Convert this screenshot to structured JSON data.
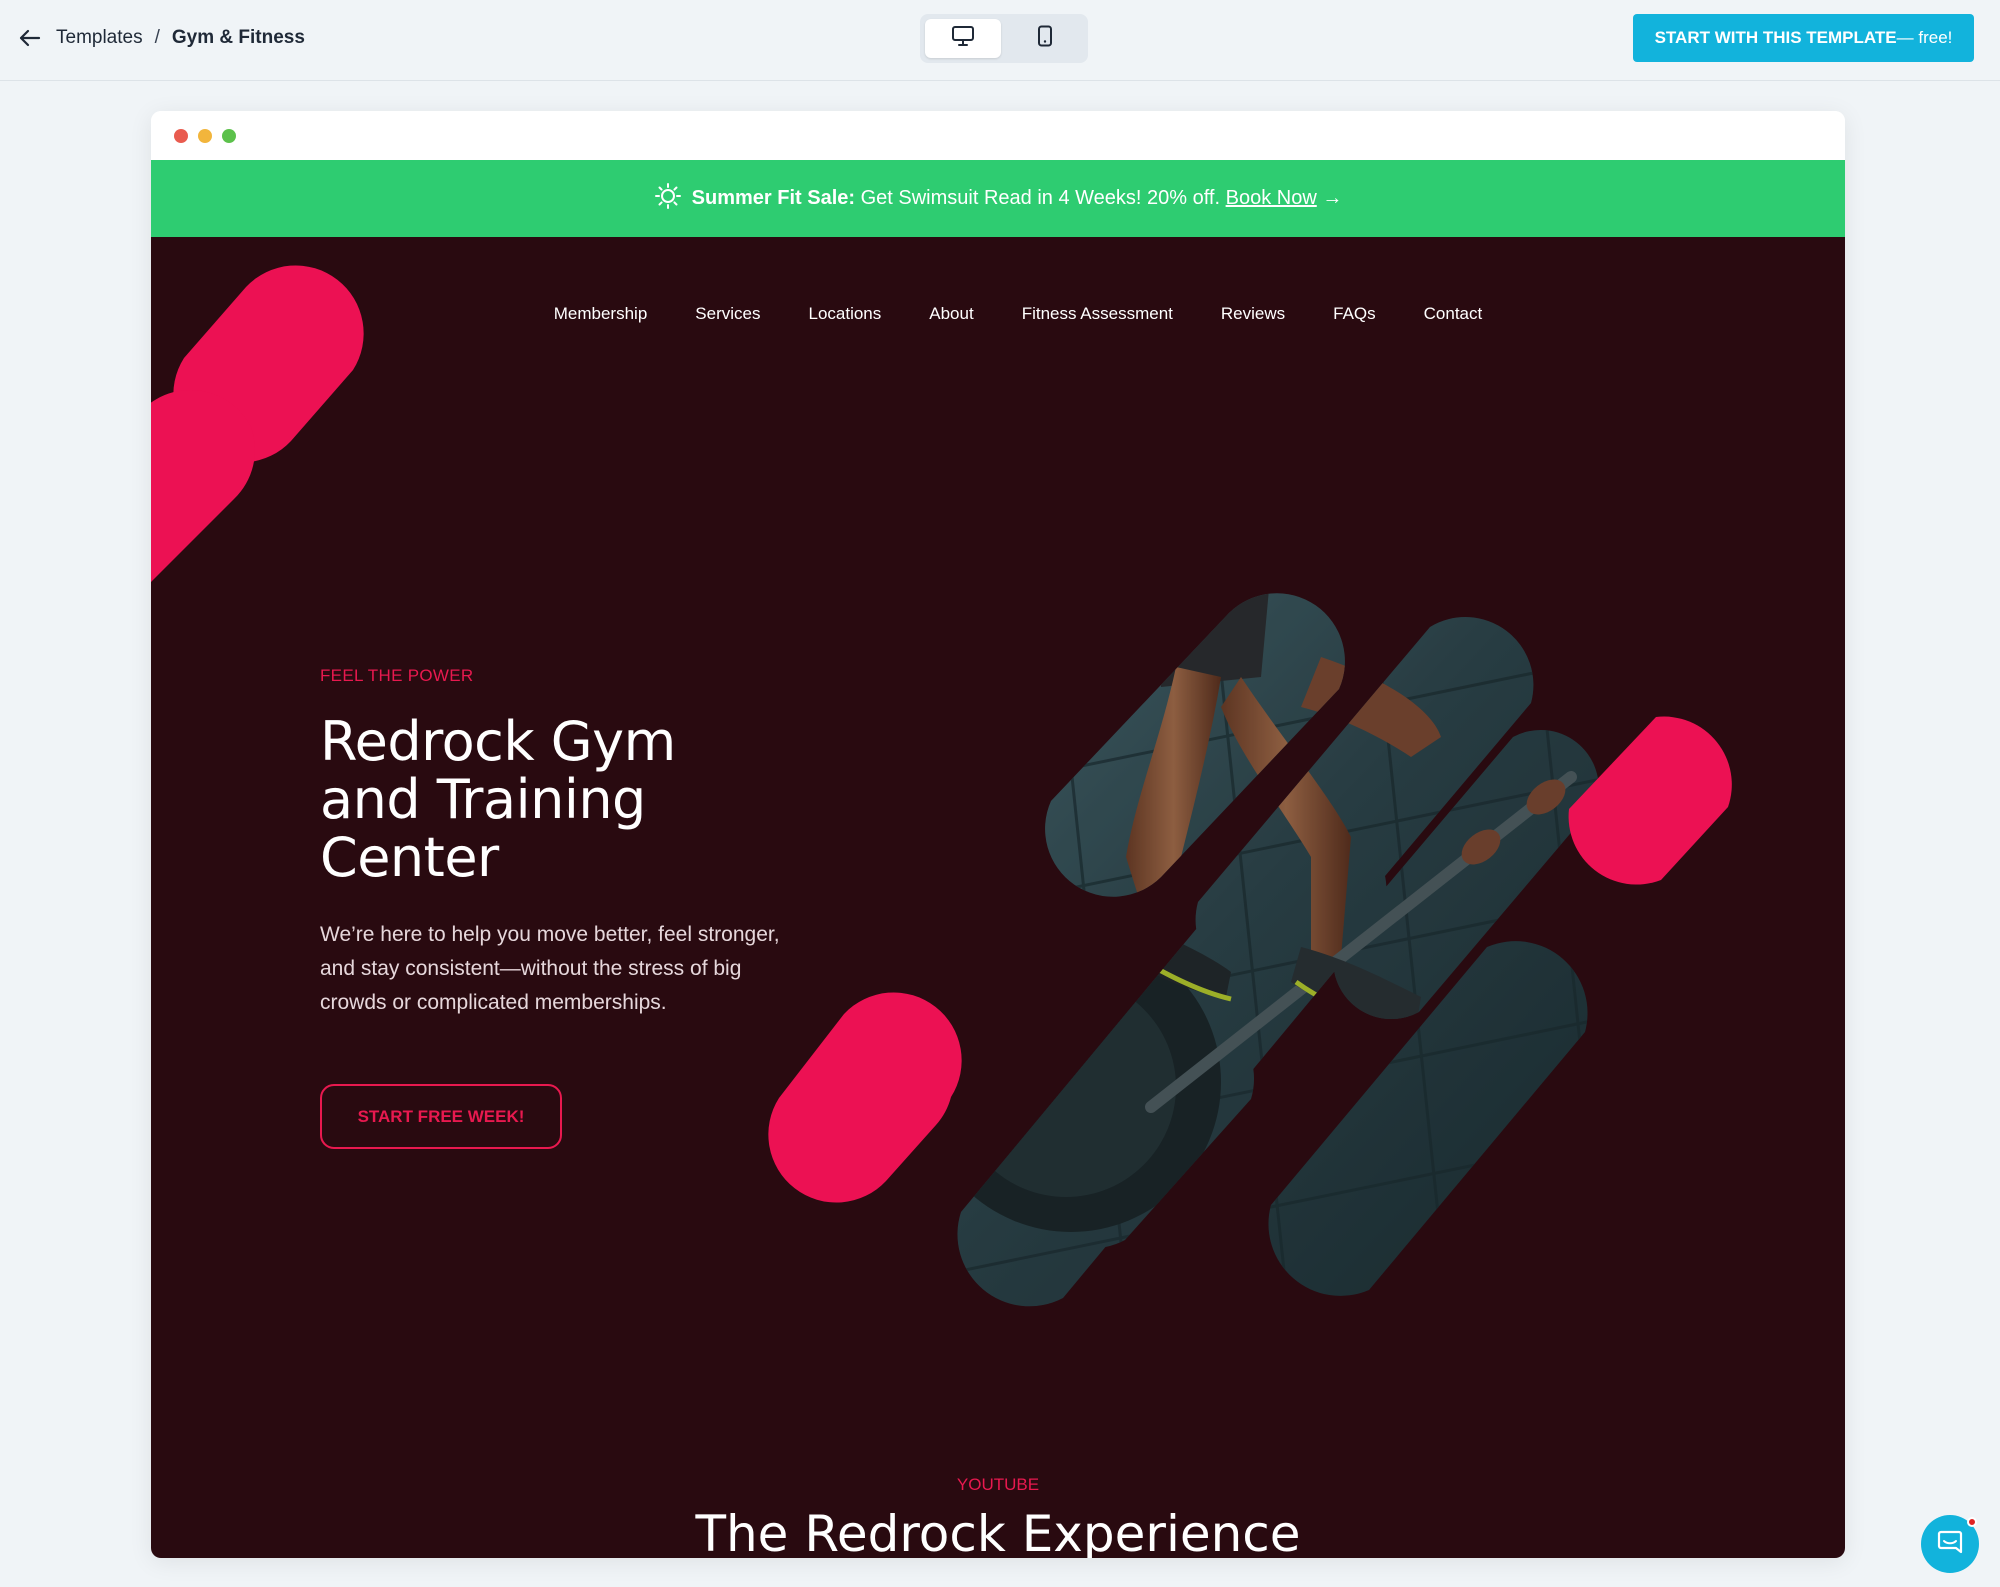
{
  "header": {
    "breadcrumb_root": "Templates",
    "breadcrumb_sep": "/",
    "breadcrumb_current": "Gym & Fitness",
    "devices": [
      "desktop-icon",
      "mobile-icon"
    ],
    "active_device": "desktop",
    "cta_strong": "START WITH THIS TEMPLATE",
    "cta_rest": " — free!"
  },
  "promo": {
    "icon": "sun-icon",
    "label": "Summer Fit Sale:",
    "text": "Get Swimsuit Read in 4 Weeks! 20% off.",
    "link": "Book Now",
    "arrow": "→",
    "color": "#2ecc71"
  },
  "nav": {
    "items": [
      "Membership",
      "Services",
      "Locations",
      "About",
      "Fitness Assessment",
      "Reviews",
      "FAQs",
      "Contact"
    ]
  },
  "hero": {
    "eyebrow": "FEEL THE POWER",
    "title": "Redrock Gym and Training Center",
    "description": "We’re here to help you move better, feel stronger, and stay consistent—without the stress of big crowds or complicated memberships.",
    "cta": "START FREE WEEK!"
  },
  "youtube": {
    "eyebrow": "YOUTUBE",
    "title": "The Redrock Experience"
  },
  "colors": {
    "accent": "#e8194f",
    "background": "#290a10",
    "brand_button": "#12b3dc"
  }
}
